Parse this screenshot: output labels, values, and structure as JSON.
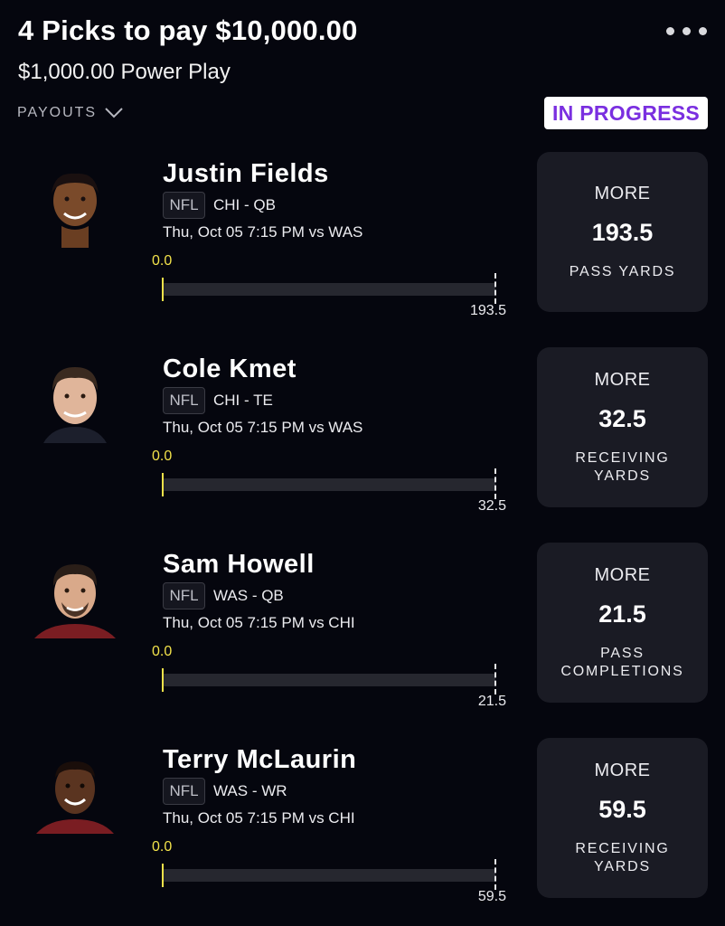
{
  "header": {
    "title": "4 Picks to pay $10,000.00",
    "subtitle": "$1,000.00 Power Play",
    "payouts_label": "PAYOUTS",
    "status": "IN PROGRESS"
  },
  "colors": {
    "background": "#05060e",
    "status_text": "#7a2fe0",
    "progress_current": "#f2e24a",
    "card": "#1a1b24"
  },
  "picks": [
    {
      "name": "Justin Fields",
      "league": "NFL",
      "team_pos": "CHI - QB",
      "game": "Thu, Oct 05 7:15 PM  vs WAS",
      "current": "0.0",
      "target": "193.5",
      "progress_fraction": 0.0,
      "direction": "MORE",
      "line": "193.5",
      "stat": "PASS YARDS"
    },
    {
      "name": "Cole Kmet",
      "league": "NFL",
      "team_pos": "CHI - TE",
      "game": "Thu, Oct 05 7:15 PM  vs WAS",
      "current": "0.0",
      "target": "32.5",
      "progress_fraction": 0.0,
      "direction": "MORE",
      "line": "32.5",
      "stat": "RECEIVING YARDS"
    },
    {
      "name": "Sam Howell",
      "league": "NFL",
      "team_pos": "WAS - QB",
      "game": "Thu, Oct 05 7:15 PM  vs CHI",
      "current": "0.0",
      "target": "21.5",
      "progress_fraction": 0.0,
      "direction": "MORE",
      "line": "21.5",
      "stat": "PASS COMPLETIONS"
    },
    {
      "name": "Terry McLaurin",
      "league": "NFL",
      "team_pos": "WAS - WR",
      "game": "Thu, Oct 05 7:15 PM  vs CHI",
      "current": "0.0",
      "target": "59.5",
      "progress_fraction": 0.0,
      "direction": "MORE",
      "line": "59.5",
      "stat": "RECEIVING YARDS"
    }
  ]
}
